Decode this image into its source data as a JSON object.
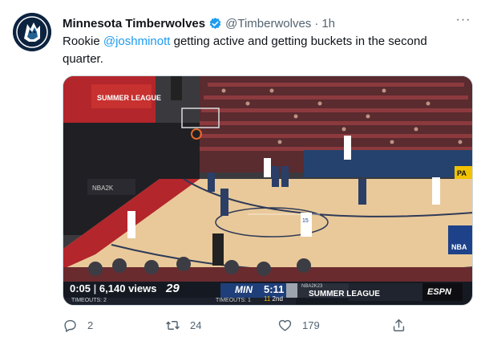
{
  "tweet": {
    "author_name": "Minnesota Timberwolves",
    "author_handle": "@Timberwolves",
    "separator": "·",
    "time": "1h",
    "more_label": "···",
    "text_before": "Rookie ",
    "mention": "@joshminott",
    "text_after": " getting active and getting buckets in the second quarter."
  },
  "video": {
    "elapsed": "0:05",
    "views": "6,140 views",
    "home_score": "29",
    "away_team": "MIN",
    "timeouts_left": "TIMEOUTS: 2",
    "timeouts_right": "TIMEOUTS: 1",
    "game_clock": "5:11",
    "shot_clock": "11",
    "period": "2nd",
    "brand_small": "NBA2K23",
    "brand": "SUMMER LEAGUE",
    "network": "ESPN",
    "court_logo": "NBA",
    "banner_text": "SUMMER LEAGUE",
    "side_ad": "PA",
    "player_number": "15"
  },
  "actions": {
    "replies": "2",
    "retweets": "24",
    "likes": "179"
  },
  "colors": {
    "link": "#1d9bf0",
    "muted": "#536471",
    "verified": "#1d9bf0",
    "wolves_navy": "#0c2340"
  }
}
